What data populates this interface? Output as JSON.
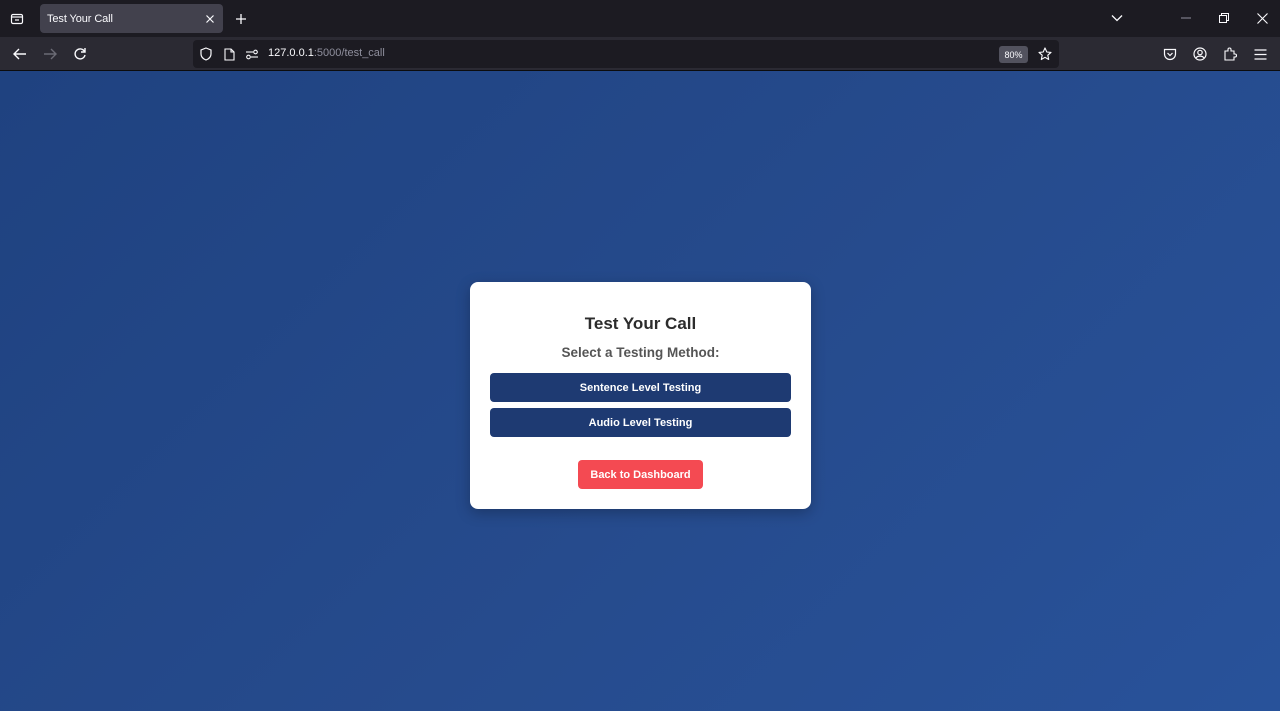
{
  "browser": {
    "tab": {
      "title": "Test Your Call"
    },
    "url": {
      "host": "127.0.0.1",
      "rest": ":5000/test_call"
    },
    "zoom": "80%"
  },
  "page": {
    "title": "Test Your Call",
    "subtitle": "Select a Testing Method:",
    "buttons": {
      "sentence": "Sentence Level Testing",
      "audio": "Audio Level Testing",
      "back": "Back to Dashboard"
    }
  },
  "colors": {
    "background": "#264b8d",
    "method_button": "#1e3a72",
    "back_button": "#f44a52"
  }
}
